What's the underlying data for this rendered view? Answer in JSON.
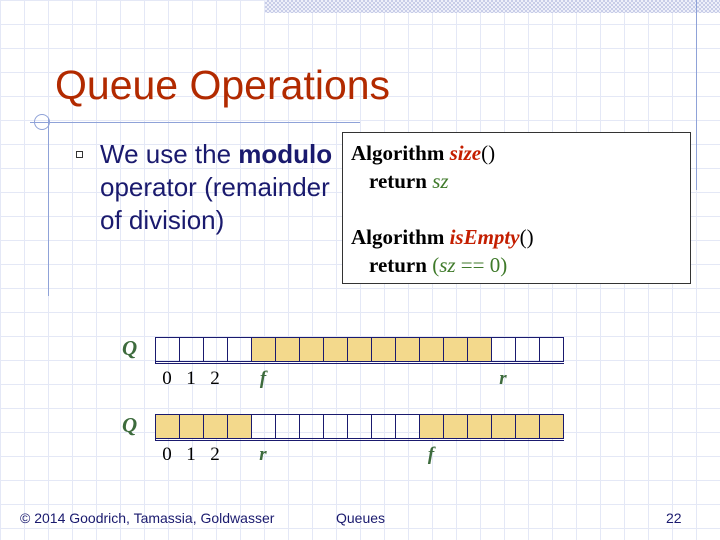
{
  "slide": {
    "title": "Queue Operations"
  },
  "bullet": {
    "text_before": "We use the ",
    "bold": "modulo",
    "text_after": " operator (remainder of division)"
  },
  "algorithms": {
    "size": {
      "keyword": "Algorithm",
      "name": "size",
      "parens": "()",
      "return_keyword": "return",
      "return_value": "sz"
    },
    "is_empty": {
      "keyword": "Algorithm",
      "name": "isEmpty",
      "parens": "()",
      "return_keyword": "return",
      "return_open": "(",
      "return_var": "sz",
      "return_rest": " == 0)"
    }
  },
  "diagrams": [
    {
      "array_label": "Q",
      "cells": [
        0,
        0,
        0,
        0,
        1,
        1,
        1,
        1,
        1,
        1,
        1,
        1,
        1,
        1,
        0,
        0,
        0
      ],
      "index_labels": [
        "0",
        "1",
        "2"
      ],
      "pointers": [
        {
          "label": "f",
          "cell": 4
        },
        {
          "label": "r",
          "cell": 14
        }
      ]
    },
    {
      "array_label": "Q",
      "cells": [
        1,
        1,
        1,
        1,
        0,
        0,
        0,
        0,
        0,
        0,
        0,
        1,
        1,
        1,
        1,
        1,
        1
      ],
      "index_labels": [
        "0",
        "1",
        "2"
      ],
      "pointers": [
        {
          "label": "r",
          "cell": 4
        },
        {
          "label": "f",
          "cell": 11
        }
      ]
    }
  ],
  "footer": {
    "copyright": "© 2014 Goodrich, Tamassia, Goldwasser",
    "topic": "Queues",
    "page_number": "22"
  },
  "colors": {
    "title": "#b22a00",
    "filled_cell": "#f3d98c",
    "cell_border": "#1a1a6e",
    "pointer": "#3d6b3d"
  }
}
